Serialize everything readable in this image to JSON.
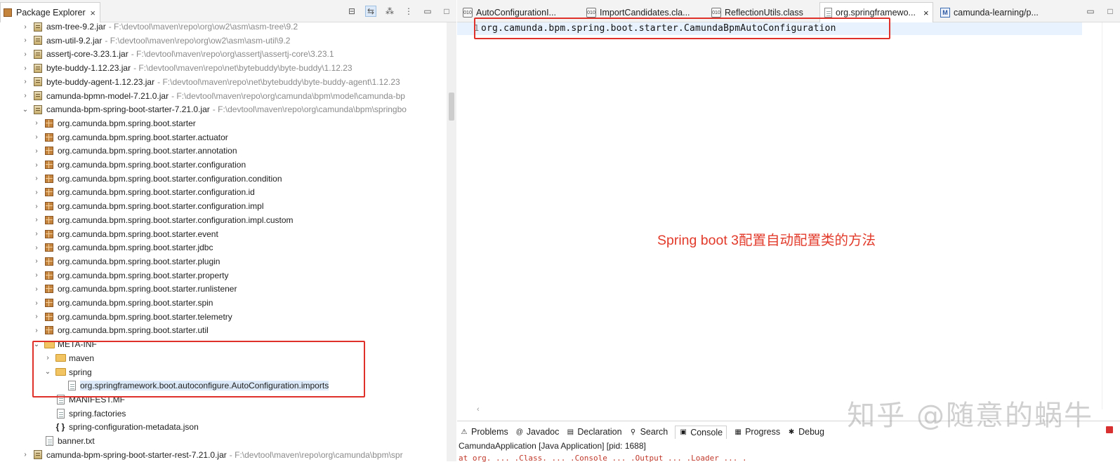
{
  "package_explorer": {
    "tab_title": "Package Explorer",
    "close_symbol": "×",
    "toolbar_icons": [
      "collapse-all-icon",
      "link-with-editor-icon",
      "filters-icon",
      "view-menu-icon",
      "minimize-icon",
      "maximize-icon"
    ]
  },
  "tree": [
    {
      "indent": 0,
      "toggle": "›",
      "icon": "jar",
      "name": "asm-tree-9.2.jar",
      "path": "- F:\\devtool\\maven\\repo\\org\\ow2\\asm\\asm-tree\\9.2"
    },
    {
      "indent": 0,
      "toggle": "›",
      "icon": "jar",
      "name": "asm-util-9.2.jar",
      "path": "- F:\\devtool\\maven\\repo\\org\\ow2\\asm\\asm-util\\9.2"
    },
    {
      "indent": 0,
      "toggle": "›",
      "icon": "jar",
      "name": "assertj-core-3.23.1.jar",
      "path": "- F:\\devtool\\maven\\repo\\org\\assertj\\assertj-core\\3.23.1"
    },
    {
      "indent": 0,
      "toggle": "›",
      "icon": "jar",
      "name": "byte-buddy-1.12.23.jar",
      "path": "- F:\\devtool\\maven\\repo\\net\\bytebuddy\\byte-buddy\\1.12.23"
    },
    {
      "indent": 0,
      "toggle": "›",
      "icon": "jar",
      "name": "byte-buddy-agent-1.12.23.jar",
      "path": "- F:\\devtool\\maven\\repo\\net\\bytebuddy\\byte-buddy-agent\\1.12.23"
    },
    {
      "indent": 0,
      "toggle": "›",
      "icon": "jar",
      "name": "camunda-bpmn-model-7.21.0.jar",
      "path": "- F:\\devtool\\maven\\repo\\org\\camunda\\bpm\\model\\camunda-bp"
    },
    {
      "indent": 0,
      "toggle": "⌄",
      "icon": "jar",
      "name": "camunda-bpm-spring-boot-starter-7.21.0.jar",
      "path": "- F:\\devtool\\maven\\repo\\org\\camunda\\bpm\\springbo"
    },
    {
      "indent": 1,
      "toggle": "›",
      "icon": "pkg",
      "name": "org.camunda.bpm.spring.boot.starter",
      "path": ""
    },
    {
      "indent": 1,
      "toggle": "›",
      "icon": "pkg",
      "name": "org.camunda.bpm.spring.boot.starter.actuator",
      "path": ""
    },
    {
      "indent": 1,
      "toggle": "›",
      "icon": "pkg",
      "name": "org.camunda.bpm.spring.boot.starter.annotation",
      "path": ""
    },
    {
      "indent": 1,
      "toggle": "›",
      "icon": "pkg",
      "name": "org.camunda.bpm.spring.boot.starter.configuration",
      "path": ""
    },
    {
      "indent": 1,
      "toggle": "›",
      "icon": "pkg",
      "name": "org.camunda.bpm.spring.boot.starter.configuration.condition",
      "path": ""
    },
    {
      "indent": 1,
      "toggle": "›",
      "icon": "pkg",
      "name": "org.camunda.bpm.spring.boot.starter.configuration.id",
      "path": ""
    },
    {
      "indent": 1,
      "toggle": "›",
      "icon": "pkg",
      "name": "org.camunda.bpm.spring.boot.starter.configuration.impl",
      "path": ""
    },
    {
      "indent": 1,
      "toggle": "›",
      "icon": "pkg",
      "name": "org.camunda.bpm.spring.boot.starter.configuration.impl.custom",
      "path": ""
    },
    {
      "indent": 1,
      "toggle": "›",
      "icon": "pkg",
      "name": "org.camunda.bpm.spring.boot.starter.event",
      "path": ""
    },
    {
      "indent": 1,
      "toggle": "›",
      "icon": "pkg",
      "name": "org.camunda.bpm.spring.boot.starter.jdbc",
      "path": ""
    },
    {
      "indent": 1,
      "toggle": "›",
      "icon": "pkg",
      "name": "org.camunda.bpm.spring.boot.starter.plugin",
      "path": ""
    },
    {
      "indent": 1,
      "toggle": "›",
      "icon": "pkg",
      "name": "org.camunda.bpm.spring.boot.starter.property",
      "path": ""
    },
    {
      "indent": 1,
      "toggle": "›",
      "icon": "pkg",
      "name": "org.camunda.bpm.spring.boot.starter.runlistener",
      "path": ""
    },
    {
      "indent": 1,
      "toggle": "›",
      "icon": "pkg",
      "name": "org.camunda.bpm.spring.boot.starter.spin",
      "path": ""
    },
    {
      "indent": 1,
      "toggle": "›",
      "icon": "pkg",
      "name": "org.camunda.bpm.spring.boot.starter.telemetry",
      "path": ""
    },
    {
      "indent": 1,
      "toggle": "›",
      "icon": "pkg",
      "name": "org.camunda.bpm.spring.boot.starter.util",
      "path": ""
    },
    {
      "indent": 1,
      "toggle": "⌄",
      "icon": "folder",
      "name": "META-INF",
      "path": ""
    },
    {
      "indent": 2,
      "toggle": "›",
      "icon": "folder",
      "name": "maven",
      "path": ""
    },
    {
      "indent": 2,
      "toggle": "⌄",
      "icon": "folder",
      "name": "spring",
      "path": ""
    },
    {
      "indent": 3,
      "toggle": "",
      "icon": "file",
      "name": "org.springframework.boot.autoconfigure.AutoConfiguration.imports",
      "path": "",
      "selected": true
    },
    {
      "indent": 2,
      "toggle": "",
      "icon": "file",
      "name": "MANIFEST.MF",
      "path": ""
    },
    {
      "indent": 2,
      "toggle": "",
      "icon": "file",
      "name": "spring.factories",
      "path": ""
    },
    {
      "indent": 2,
      "toggle": "",
      "icon": "json",
      "name": "spring-configuration-metadata.json",
      "path": ""
    },
    {
      "indent": 1,
      "toggle": "",
      "icon": "file",
      "name": "banner.txt",
      "path": ""
    },
    {
      "indent": 0,
      "toggle": "›",
      "icon": "jar",
      "name": "camunda-bpm-spring-boot-starter-rest-7.21.0.jar",
      "path": "- F:\\devtool\\maven\\repo\\org\\camunda\\bpm\\spr"
    }
  ],
  "editor": {
    "tabs": [
      {
        "label": "AutoConfigurationI...",
        "icon": "class",
        "active": false
      },
      {
        "label": "ImportCandidates.cla...",
        "icon": "class",
        "active": false
      },
      {
        "label": "ReflectionUtils.class",
        "icon": "class",
        "active": false
      },
      {
        "label": "org.springframewo...",
        "icon": "file",
        "active": true
      },
      {
        "label": "camunda-learning/p...",
        "icon": "maven",
        "active": false
      }
    ],
    "line_number": "1",
    "code_line": "org.camunda.bpm.spring.boot.starter.CamundaBpmAutoConfiguration",
    "annotation": "Spring boot 3配置自动配置类的方法",
    "scroll_left_arrow": "‹",
    "close_symbol": "×"
  },
  "bottom_panel": {
    "tabs": [
      {
        "label": "Problems",
        "icon": "problems-icon",
        "glyph": "⚠"
      },
      {
        "label": "Javadoc",
        "icon": "javadoc-icon",
        "glyph": "@"
      },
      {
        "label": "Declaration",
        "icon": "declaration-icon",
        "glyph": "▤"
      },
      {
        "label": "Search",
        "icon": "search-icon",
        "glyph": "⚲"
      },
      {
        "label": "Console",
        "icon": "console-icon",
        "glyph": "▣",
        "active": true
      },
      {
        "label": "Progress",
        "icon": "progress-icon",
        "glyph": "▦"
      },
      {
        "label": "Debug",
        "icon": "debug-icon",
        "glyph": "✱"
      }
    ],
    "console_title": "CamundaApplication [Java Application]  [pid: 1688]",
    "console_partial_line": "at org. ... .Class. ... .Console ... .Output ... .Loader ... ."
  },
  "watermark": "知乎 @随意的蜗牛",
  "colors": {
    "highlight_box": "#e0302a",
    "annotation": "#e23a2a",
    "selection": "#dbe9f8"
  }
}
